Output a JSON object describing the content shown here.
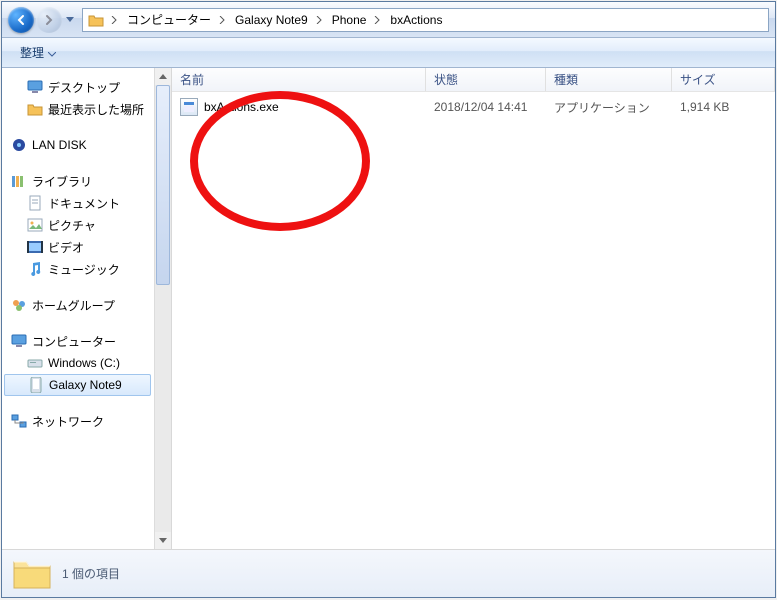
{
  "breadcrumbs": [
    "コンピューター",
    "Galaxy Note9",
    "Phone",
    "bxActions"
  ],
  "toolbar": {
    "organize": "整理"
  },
  "columns": {
    "name": "名前",
    "date": "状態",
    "type": "種類",
    "size": "サイズ"
  },
  "rows": [
    {
      "name": "bxActions.exe",
      "date": "2018/12/04 14:41",
      "type": "アプリケーション",
      "size": "1,914 KB"
    }
  ],
  "sidebar": {
    "desktop": "デスクトップ",
    "recent": "最近表示した場所",
    "landisk": "LAN DISK",
    "libraries": "ライブラリ",
    "documents": "ドキュメント",
    "pictures": "ピクチャ",
    "videos": "ビデオ",
    "music": "ミュージック",
    "homegroup": "ホームグループ",
    "computer": "コンピューター",
    "cdrive": "Windows (C:)",
    "phone": "Galaxy Note9",
    "network": "ネットワーク"
  },
  "status": {
    "count": "1 個の項目"
  }
}
